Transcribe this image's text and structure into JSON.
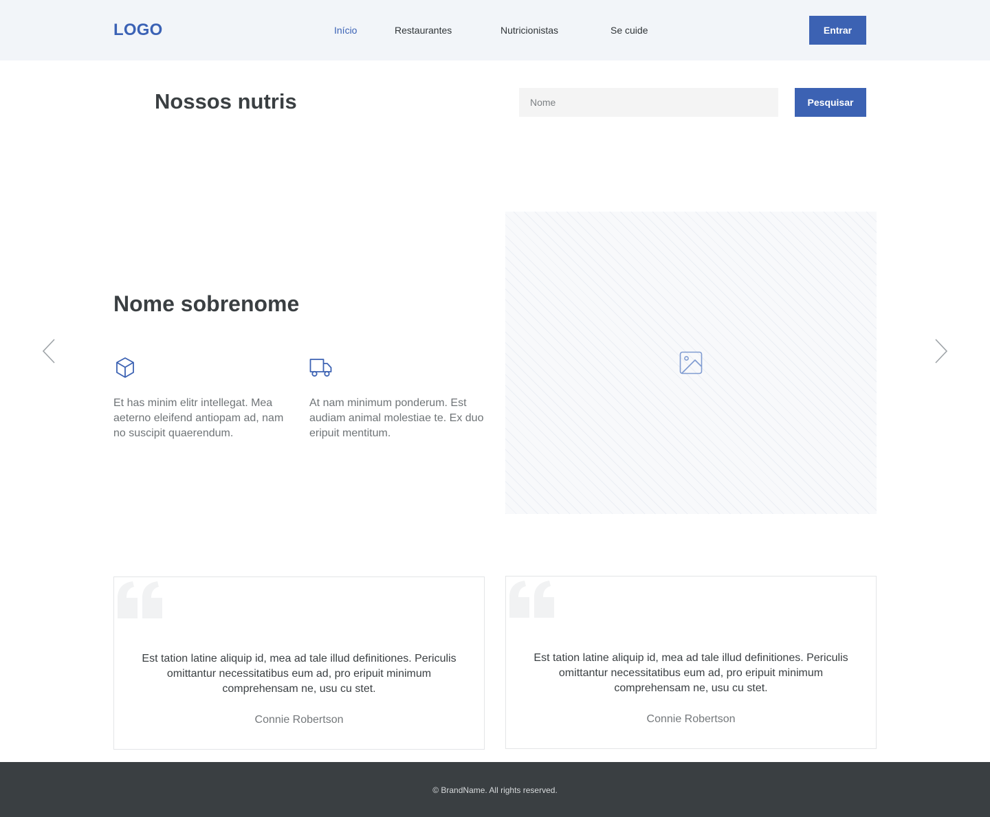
{
  "header": {
    "logo": "LOGO",
    "nav": [
      {
        "label": "Início",
        "active": true
      },
      {
        "label": "Restaurantes",
        "active": false
      },
      {
        "label": "Nutricionistas",
        "active": false
      },
      {
        "label": "Se cuide",
        "active": false
      }
    ],
    "login_label": "Entrar"
  },
  "search": {
    "title": "Nossos nutris",
    "placeholder": "Nome",
    "button_label": "Pesquisar"
  },
  "profile": {
    "name": "Nome sobrenome",
    "features": [
      {
        "icon": "box-icon",
        "text": "Et has minim elitr intellegat. Mea aeterno eleifend antiopam ad, nam no suscipit quaerendum."
      },
      {
        "icon": "truck-icon",
        "text": "At nam minimum ponderum. Est audiam animal molestiae te. Ex duo eripuit mentitum."
      }
    ],
    "image_icon": "image-icon"
  },
  "testimonials": [
    {
      "text": "Est tation latine aliquip id, mea ad tale illud definitiones. Periculis omittantur necessitatibus eum ad, pro eripuit minimum comprehensam ne, usu cu stet.",
      "author": "Connie Robertson"
    },
    {
      "text": "Est tation latine aliquip id, mea ad tale illud definitiones. Periculis omittantur necessitatibus eum ad, pro eripuit minimum comprehensam ne, usu cu stet.",
      "author": "Connie Robertson"
    }
  ],
  "footer": {
    "copyright": "© BrandName. All rights reserved."
  },
  "colors": {
    "accent": "#3c62b3",
    "header_bg": "#f2f5f9",
    "footer_bg": "#3a3f42"
  }
}
